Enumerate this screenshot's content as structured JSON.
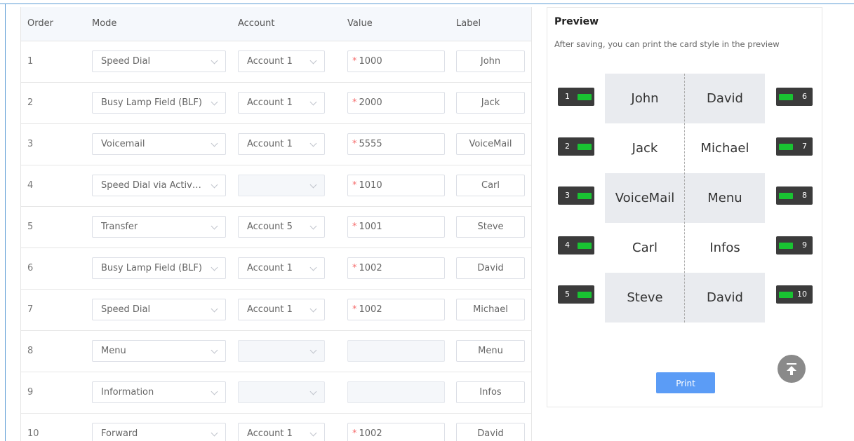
{
  "table": {
    "headers": {
      "order": "Order",
      "mode": "Mode",
      "account": "Account",
      "value": "Value",
      "label": "Label"
    },
    "rows": [
      {
        "order": "1",
        "mode": "Speed Dial",
        "account": "Account 1",
        "value": "1000",
        "label": "John"
      },
      {
        "order": "2",
        "mode": "Busy Lamp Field (BLF)",
        "account": "Account 1",
        "value": "2000",
        "label": "Jack"
      },
      {
        "order": "3",
        "mode": "Voicemail",
        "account": "Account 1",
        "value": "5555",
        "label": "VoiceMail"
      },
      {
        "order": "4",
        "mode": "Speed Dial via Active...",
        "account": "",
        "value": "1010",
        "label": "Carl"
      },
      {
        "order": "5",
        "mode": "Transfer",
        "account": "Account 5",
        "value": "1001",
        "label": "Steve"
      },
      {
        "order": "6",
        "mode": "Busy Lamp Field (BLF)",
        "account": "Account 1",
        "value": "1002",
        "label": "David"
      },
      {
        "order": "7",
        "mode": "Speed Dial",
        "account": "Account 1",
        "value": "1002",
        "label": "Michael"
      },
      {
        "order": "8",
        "mode": "Menu",
        "account": "",
        "value": "",
        "label": "Menu"
      },
      {
        "order": "9",
        "mode": "Information",
        "account": "",
        "value": "",
        "label": "Infos"
      },
      {
        "order": "10",
        "mode": "Forward",
        "account": "Account 1",
        "value": "1002",
        "label": "David"
      }
    ],
    "required_mark": "*"
  },
  "preview": {
    "title": "Preview",
    "subtitle": "After saving, you can print the card style in the preview",
    "card_left": [
      "John",
      "Jack",
      "VoiceMail",
      "Carl",
      "Steve"
    ],
    "card_right": [
      "David",
      "Michael",
      "Menu",
      "Infos",
      "David"
    ],
    "keys_left": [
      "1",
      "2",
      "3",
      "4",
      "5"
    ],
    "keys_right": [
      "6",
      "7",
      "8",
      "9",
      "10"
    ],
    "print_label": "Print",
    "led_color": "#19c332",
    "print_color": "#5b9cf6",
    "back_to_top_icon": "arrow-up-to-line-icon"
  }
}
